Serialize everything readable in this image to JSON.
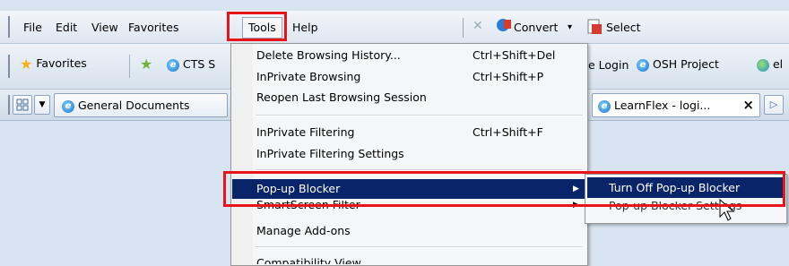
{
  "menubar": {
    "file": "File",
    "edit": "Edit",
    "view": "View",
    "favorites": "Favorites",
    "tools": "Tools",
    "help": "Help"
  },
  "toolbar": {
    "convert": "Convert",
    "convert_arrow": "▾",
    "select": "Select"
  },
  "favbar": {
    "favorites": "Favorites",
    "cts_partial": "CTS S",
    "login_partial": "e Login",
    "osh_project": "OSH Project",
    "trailing_partial": "el"
  },
  "tabbar": {
    "general_documents": "General Documents",
    "learnflex_tab": "LearnFlex - logi...",
    "close_glyph": "×"
  },
  "tools_menu": {
    "items": [
      {
        "label": "Delete Browsing History...",
        "shortcut": "Ctrl+Shift+Del"
      },
      {
        "label": "InPrivate Browsing",
        "shortcut": "Ctrl+Shift+P"
      },
      {
        "label": "Reopen Last Browsing Session",
        "shortcut": ""
      },
      {
        "label": "InPrivate Filtering",
        "shortcut": "Ctrl+Shift+F"
      },
      {
        "label": "InPrivate Filtering Settings",
        "shortcut": ""
      },
      {
        "label": "Pop-up Blocker",
        "shortcut": ""
      },
      {
        "label": "SmartScreen Filter",
        "shortcut": ""
      },
      {
        "label": "Manage Add-ons",
        "shortcut": ""
      },
      {
        "label": "Compatibility View",
        "shortcut": ""
      }
    ],
    "highlight_color": "#0a246a"
  },
  "popup_submenu": {
    "items": [
      {
        "label": "Turn Off Pop-up Blocker"
      },
      {
        "label": "Pop-up Blocker Settings"
      }
    ]
  },
  "colors": {
    "annotation_red": "#e8141a",
    "menu_highlight": "#0a246a"
  }
}
